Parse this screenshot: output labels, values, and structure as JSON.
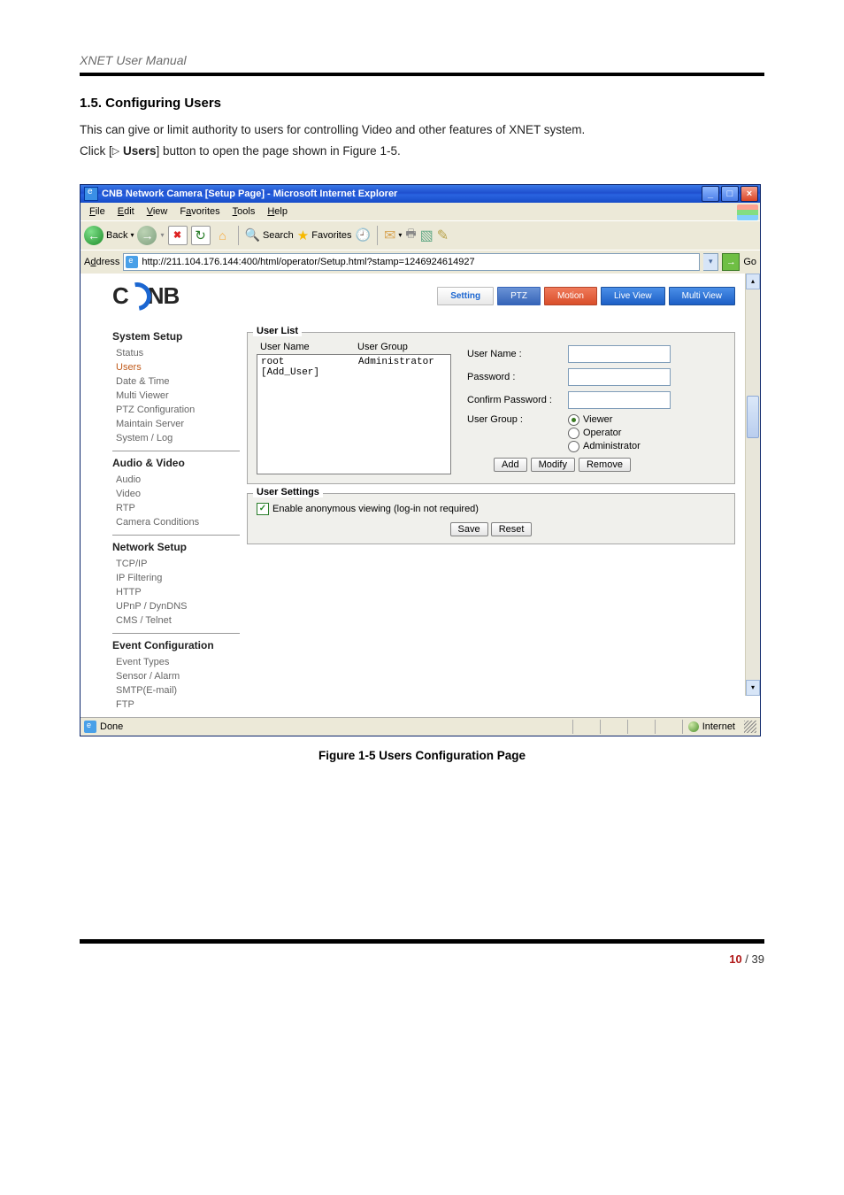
{
  "doc_header": "XNET User Manual",
  "section_heading": "1.5. Configuring Users",
  "intro_line": "This can give or limit authority to users for controlling Video and other features of XNET system.",
  "click_line_prefix": "Click [",
  "click_line_symbol": "▷",
  "click_line_bold": "Users",
  "click_line_suffix": "] button to open the page shown in Figure 1-5.",
  "figure_caption": "Figure 1-5 Users Configuration Page",
  "page_footer_current": "10",
  "page_footer_sep": " / ",
  "page_footer_total": "39",
  "win_title": "CNB Network Camera [Setup Page] - Microsoft Internet Explorer",
  "menu": {
    "file": "File",
    "edit": "Edit",
    "view": "View",
    "fav": "Favorites",
    "tools": "Tools",
    "help": "Help"
  },
  "toolbar": {
    "back": "Back",
    "search": "Search",
    "favorites": "Favorites"
  },
  "addressbar": {
    "label": "Address",
    "url": "http://211.104.176.144:400/html/operator/Setup.html?stamp=1246924614927",
    "go": "Go"
  },
  "logo": "CNB",
  "tabs": {
    "setting": "Setting",
    "ptz": "PTZ",
    "motion": "Motion",
    "live": "Live View",
    "multi": "Multi View"
  },
  "sidebar": {
    "g1": "System Setup",
    "g1_items": {
      "status": "Status",
      "users": "Users",
      "datetime": "Date & Time",
      "multiviewer": "Multi Viewer",
      "ptzcfg": "PTZ Configuration",
      "maintain": "Maintain Server",
      "syslog": "System / Log"
    },
    "g2": "Audio & Video",
    "g2_items": {
      "audio": "Audio",
      "video": "Video",
      "rtp": "RTP",
      "camcond": "Camera Conditions"
    },
    "g3": "Network Setup",
    "g3_items": {
      "tcpip": "TCP/IP",
      "ipfilter": "IP Filtering",
      "http": "HTTP",
      "upnp": "UPnP / DynDNS",
      "cms": "CMS / Telnet"
    },
    "g4": "Event Configuration",
    "g4_items": {
      "etypes": "Event Types",
      "sensor": "Sensor / Alarm",
      "smtp": "SMTP(E-mail)",
      "ftp": "FTP"
    }
  },
  "userlist": {
    "legend": "User List",
    "col_name": "User Name",
    "col_group": "User Group",
    "row1_name": "root",
    "row1_group": "Administrator",
    "row2_name": "[Add_User]",
    "f_username": "User Name :",
    "f_password": "Password :",
    "f_confirm": "Confirm Password :",
    "f_usergroup": "User Group :",
    "r_viewer": "Viewer",
    "r_operator": "Operator",
    "r_admin": "Administrator",
    "btn_add": "Add",
    "btn_modify": "Modify",
    "btn_remove": "Remove"
  },
  "usersettings": {
    "legend": "User Settings",
    "chk_label": "Enable anonymous viewing (log-in not required)",
    "btn_save": "Save",
    "btn_reset": "Reset"
  },
  "status": {
    "done": "Done",
    "internet": "Internet"
  }
}
